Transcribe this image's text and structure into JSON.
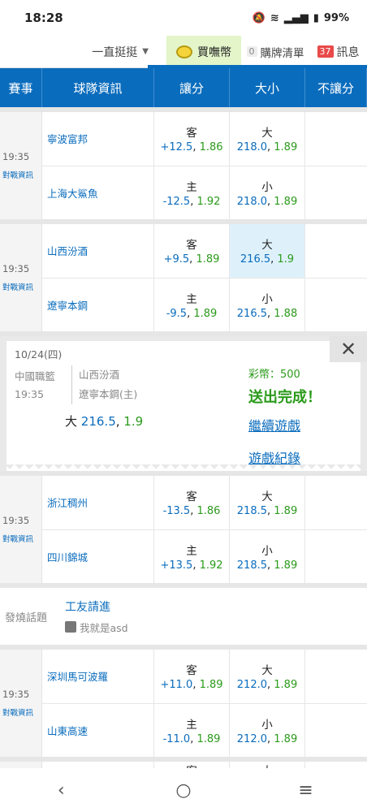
{
  "status": {
    "time": "18:28",
    "battery": "99%"
  },
  "topbar": {
    "sort_label": "一直挺挺",
    "buy_label": "買嘸幣",
    "cart_count": "0",
    "cart_label": "購牌清單",
    "msg_count": "37",
    "msg_label": "訊息"
  },
  "header": [
    "賽事",
    "球隊資訊",
    "讓分",
    "大小",
    "不讓分"
  ],
  "matches": [
    {
      "time": "19:35",
      "info": "對戰資訊",
      "away": {
        "team": "寧波富邦",
        "spread_side": "客",
        "spread_line": "+12.5",
        "spread_rate": "1.86",
        "ou_side": "大",
        "ou_line": "218.0",
        "ou_rate": "1.89"
      },
      "home": {
        "team": "上海大鯊魚",
        "spread_side": "主",
        "spread_line": "-12.5",
        "spread_rate": "1.92",
        "ou_side": "小",
        "ou_line": "218.0",
        "ou_rate": "1.89"
      }
    },
    {
      "time": "19:35",
      "info": "對戰資訊",
      "away": {
        "team": "山西汾酒",
        "spread_side": "客",
        "spread_line": "+9.5",
        "spread_rate": "1.89",
        "ou_side": "大",
        "ou_line": "216.5",
        "ou_rate": "1.9"
      },
      "home": {
        "team": "遼寧本鋼",
        "spread_side": "主",
        "spread_line": "-9.5",
        "spread_rate": "1.89",
        "ou_side": "小",
        "ou_line": "216.5",
        "ou_rate": "1.88"
      }
    },
    {
      "time": "19:35",
      "info": "對戰資訊",
      "away": {
        "team": "浙江稠州",
        "spread_side": "客",
        "spread_line": "-13.5",
        "spread_rate": "1.86",
        "ou_side": "大",
        "ou_line": "218.5",
        "ou_rate": "1.89"
      },
      "home": {
        "team": "四川錦城",
        "spread_side": "主",
        "spread_line": "+13.5",
        "spread_rate": "1.92",
        "ou_side": "小",
        "ou_line": "218.5",
        "ou_rate": "1.89"
      }
    },
    {
      "time": "19:35",
      "info": "對戰資訊",
      "away": {
        "team": "深圳馬可波羅",
        "spread_side": "客",
        "spread_line": "+11.0",
        "spread_rate": "1.89",
        "ou_side": "大",
        "ou_line": "212.0",
        "ou_rate": "1.89"
      },
      "home": {
        "team": "山東高速",
        "spread_side": "主",
        "spread_line": "-11.0",
        "spread_rate": "1.89",
        "ou_side": "小",
        "ou_line": "212.0",
        "ou_rate": "1.89"
      }
    }
  ],
  "popup": {
    "date": "10/24(四)",
    "league": "中國職籃",
    "time": "19:35",
    "team1": "山西汾酒",
    "team2": "遼寧本鋼(主)",
    "bet_side": "大",
    "bet_line": "216.5",
    "bet_rate": "1.9",
    "coins": "彩幣：500",
    "done": "送出完成！",
    "continue": "繼續遊戲",
    "records": "遊戲紀錄",
    "close": "✕"
  },
  "topic": {
    "label": "發燒話題",
    "title": "工友請進",
    "user": "我就是asd"
  },
  "partial": {
    "spread_side": "客",
    "ou_side": "大"
  },
  "colors": {
    "primary": "#0a6cbd",
    "green": "#2a9a1a",
    "selected": "#def1fb"
  }
}
